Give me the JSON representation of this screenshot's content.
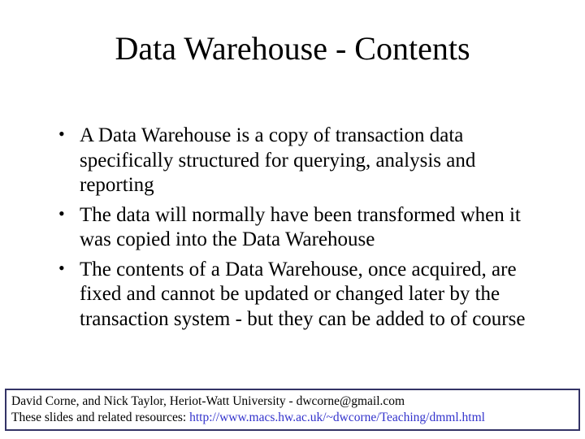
{
  "title": "Data Warehouse - Contents",
  "bullets": [
    "A Data Warehouse is a copy of transaction data specifically structured for querying, analysis and reporting",
    " The data will normally have been transformed when it was copied into the Data Warehouse",
    "The contents of a Data Warehouse, once acquired, are fixed and cannot be updated or changed later by the transaction system - but they can be added to of course"
  ],
  "footer": {
    "line1": "David Corne, and Nick Taylor,  Heriot-Watt University  -  dwcorne@gmail.com",
    "line2_prefix": "These slides and related resources:   ",
    "link_text": "http://www.macs.hw.ac.uk/~dwcorne/Teaching/dmml.html"
  }
}
